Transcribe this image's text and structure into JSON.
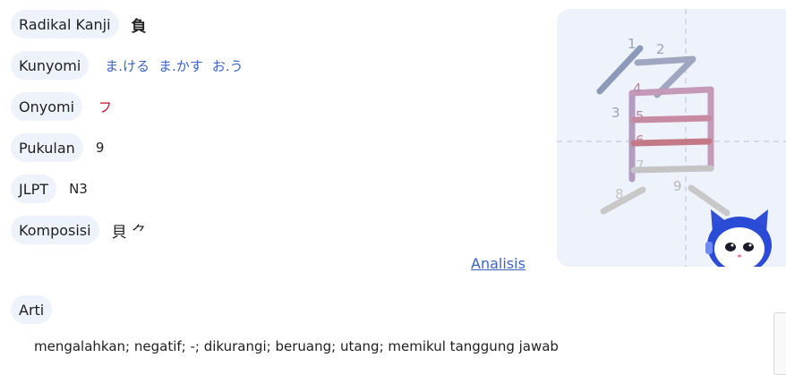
{
  "rows": {
    "radical": {
      "label": "Radikal Kanji",
      "value": "負"
    },
    "kunyomi": {
      "label": "Kunyomi",
      "values": [
        "ま.ける",
        "ま.かす",
        "お.う"
      ]
    },
    "onyomi": {
      "label": "Onyomi",
      "value": "フ"
    },
    "strokes": {
      "label": "Pukulan",
      "value": "9"
    },
    "jlpt": {
      "label": "JLPT",
      "value": "N3"
    },
    "composition": {
      "label": "Komposisi",
      "value": "貝 ⺈"
    }
  },
  "analysis_link": "Analisis",
  "meaning": {
    "label": "Arti",
    "text": "mengalahkan; negatif; -; dikurangi; beruang; utang; memikul tanggung jawab"
  },
  "stroke_order": {
    "numbers": [
      "1",
      "2",
      "3",
      "4",
      "5",
      "6",
      "7",
      "8",
      "9"
    ],
    "colors": {
      "stroke1": "#8a9ab8",
      "stroke2": "#9ea6c0",
      "stroke3": "#b39cc0",
      "stroke4": "#c49ab8",
      "stroke5": "#c88aa0",
      "stroke6": "#c47a86",
      "stroke7": "#c4c4c4",
      "stroke8": "#c8c8c8",
      "stroke9": "#c8c8c8"
    },
    "mascot_icon": "robot-cat-mascot-icon"
  },
  "colors": {
    "pill_bg": "#eef2fb",
    "link": "#3a63c8",
    "onyomi": "#c8102e"
  }
}
